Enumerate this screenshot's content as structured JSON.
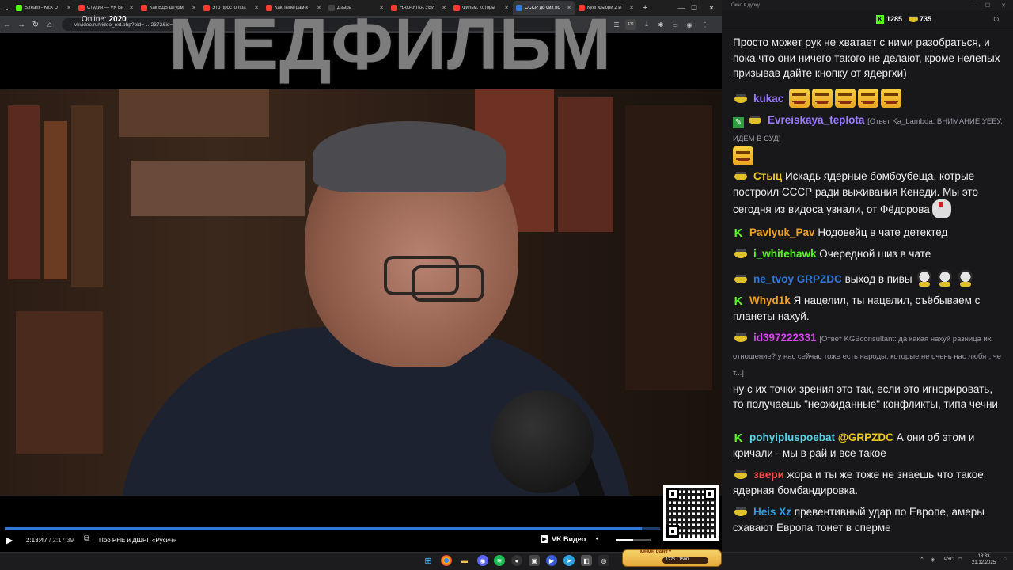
{
  "browser": {
    "tabs": [
      {
        "title": "Stream - Kick D",
        "color": "#53fc18"
      },
      {
        "title": "Студия — VK Ви",
        "color": "#ff3b30"
      },
      {
        "title": "Как ВДВ штурм",
        "color": "#ff3b30"
      },
      {
        "title": "Это просто пра",
        "color": "#ff3b30"
      },
      {
        "title": "Как Телеграм-к",
        "color": "#ff3b30"
      },
      {
        "title": "Дзыра",
        "color": "#444"
      },
      {
        "title": "НАКРУТКА УБИ",
        "color": "#ff3b30"
      },
      {
        "title": "Фильм, которы",
        "color": "#ff3b30"
      },
      {
        "title": "СССР до сих по",
        "color": "#2f78d8"
      },
      {
        "title": "Кунг Фьюри 2 И",
        "color": "#ff3b30"
      }
    ],
    "url": "vkvideo.ru/video_ext.php?oid=-…2372&id=4…562",
    "ext_badge": "431"
  },
  "video": {
    "brand": "МЕДФИЛЬМ",
    "current_time": "2:13:47",
    "duration": "2:17:39",
    "separator": " / ",
    "progress": 0.972,
    "chapter": "Про РНЕ и ДШРГ «Русич»",
    "provider": "VK Видео",
    "volume": 0.5
  },
  "meme_party": {
    "title": "MEME PARTY",
    "count": "1275 / 1500"
  },
  "chat": {
    "window_title": "Окно в дурку",
    "online_label": "Online:",
    "online_count": "2020",
    "points_k": "1285",
    "points_g": "735",
    "messages": [
      {
        "text": "Просто может рук не хватает с ними разобраться, и пока что они ничего такого не делают, кроме нелепых призывав дайте кнопку от ядергхи)"
      },
      {
        "user": "kukac",
        "color": "#9b7bff",
        "badge": "g",
        "emotes": 5
      },
      {
        "user": "Evreiskaya_teplota",
        "color": "#9b7bff",
        "badge": "pen+g",
        "reply": "[Ответ Ka_Lambda: ВНИМАНИЕ УЕБУ, ИДЁМ В СУД]",
        "emotes": 1
      },
      {
        "user": "Стыц",
        "color": "#f0c814",
        "badge": "g",
        "text": "Искадь ядерные бомбоубеща, котрые построил СССР ради выживания Кенеди. Мы это сегодня из видоса узнали, от Фёдорова"
      },
      {
        "user": "Pavlyuk_Pav",
        "color": "#f0a020",
        "badge": "k",
        "text": "Нодовейц в чате детектед"
      },
      {
        "user": "i_whitehawk",
        "color": "#53fc18",
        "badge": "g",
        "text": "Очередной шиз в чате"
      },
      {
        "user": "ne_tvoy",
        "color": "#2f78d8",
        "badge": "g",
        "mention": "GRPZDC",
        "mention_color": "#2f78d8",
        "text": "выход в пивы"
      },
      {
        "user": "Whyd1k",
        "color": "#f0a020",
        "badge": "k",
        "text": "Я нацелил, ты нацелил, съёбываем с планеты нахуй."
      },
      {
        "user": "id397222331",
        "color": "#d946ef",
        "badge": "g",
        "reply": "[Ответ KGBconsultant: да какая нахуй разница их отношение? у нас сейчас тоже есть народы, которые не очень нас любят, че т...]",
        "text": "ну с их точки зрения это так, если это игнорировать, то получаешь \"неожиданные\" конфликты, типа чечни"
      },
      {
        "user": "pohyiplusрoebat",
        "color": "#5ad1e6",
        "badge": "k",
        "mention": "@GRPZDC",
        "mention_color": "#f0c814",
        "text": "А они об этом и кричали - мы в рай и все такое"
      },
      {
        "user": "звери",
        "color": "#ff4d4d",
        "badge": "g",
        "text": "жора и ты же тоже не знаешь что такое ядерная бомбандировка."
      },
      {
        "user": "Heis Xz",
        "color": "#2f9ae0",
        "badge": "g",
        "text": "превентивный удар по Европе, амеры схавают Европа тонет в сперме"
      }
    ]
  },
  "taskbar": {
    "lang": "РУС",
    "time": "18:33",
    "date": "21.12.2025"
  }
}
